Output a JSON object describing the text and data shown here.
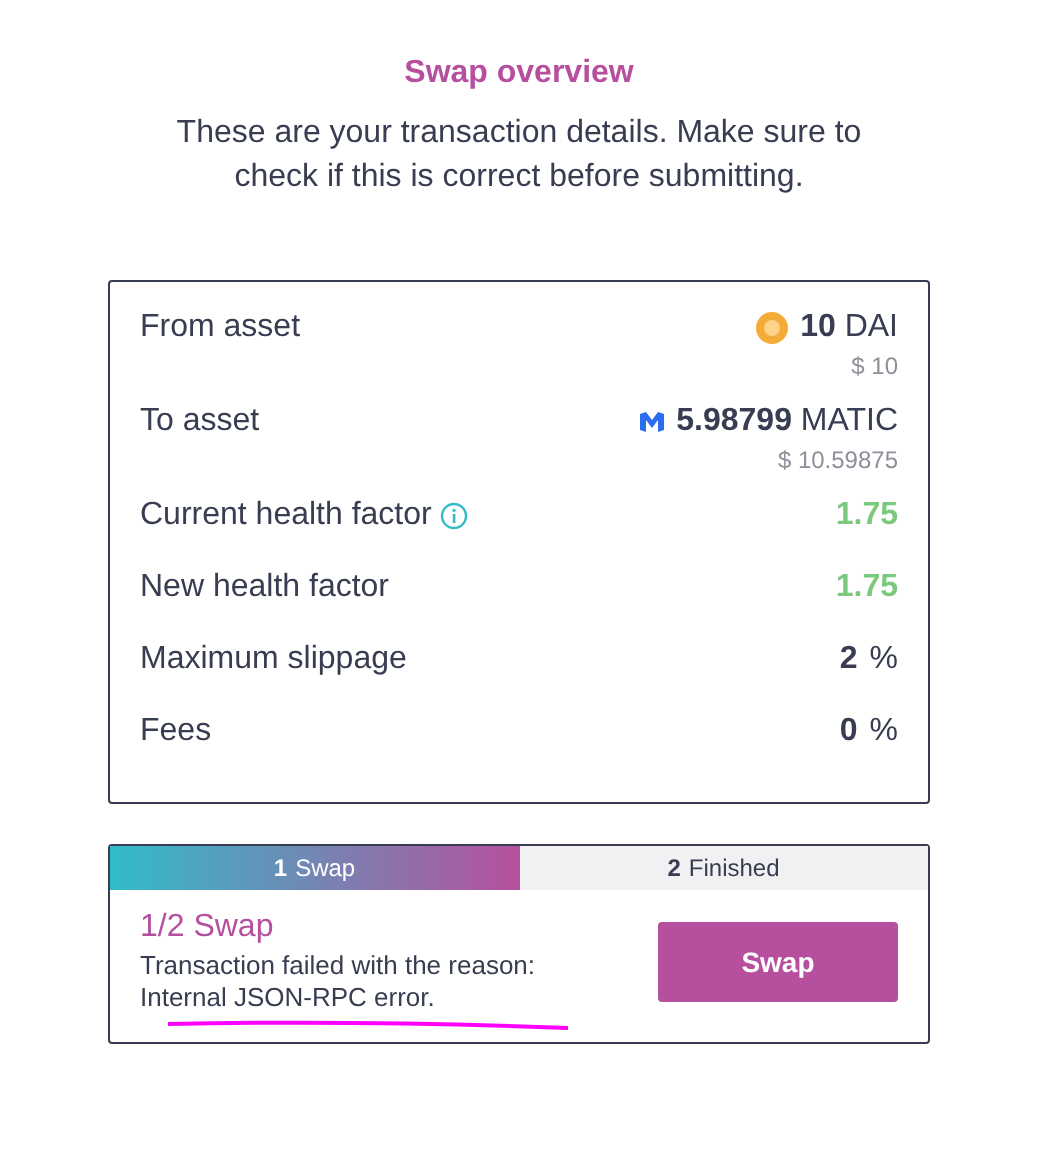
{
  "title": "Swap overview",
  "subtitle": "These are your transaction details. Make sure to check if this is correct before submitting.",
  "details": [
    {
      "kind": "asset",
      "label": "From asset",
      "value": "**10** DAI",
      "usd": "$ 10"
    },
    {
      "kind": "asset",
      "label": "To asset",
      "value": "**5.98799** MATIC",
      "usd": "$ 10.59875"
    },
    {
      "kind": "health",
      "label": "Current health factor",
      "info": true,
      "value": "1.75"
    },
    {
      "kind": "health",
      "label": "New health factor",
      "info": false,
      "value": "1.75"
    },
    {
      "kind": "plain",
      "label": "Maximum slippage",
      "value": "**2** %"
    },
    {
      "kind": "plain",
      "label": "Fees",
      "value": "**0** %"
    }
  ],
  "steps": [
    {
      "number": "1",
      "label": "Swap",
      "selected": true
    },
    {
      "number": "2",
      "label": "Finished",
      "selected": false
    }
  ],
  "step_title": "1/2 Swap",
  "step_message": "Transaction failed with the reason: Internal JSON-RPC error.",
  "underlined": true,
  "action_button": "Swap"
}
